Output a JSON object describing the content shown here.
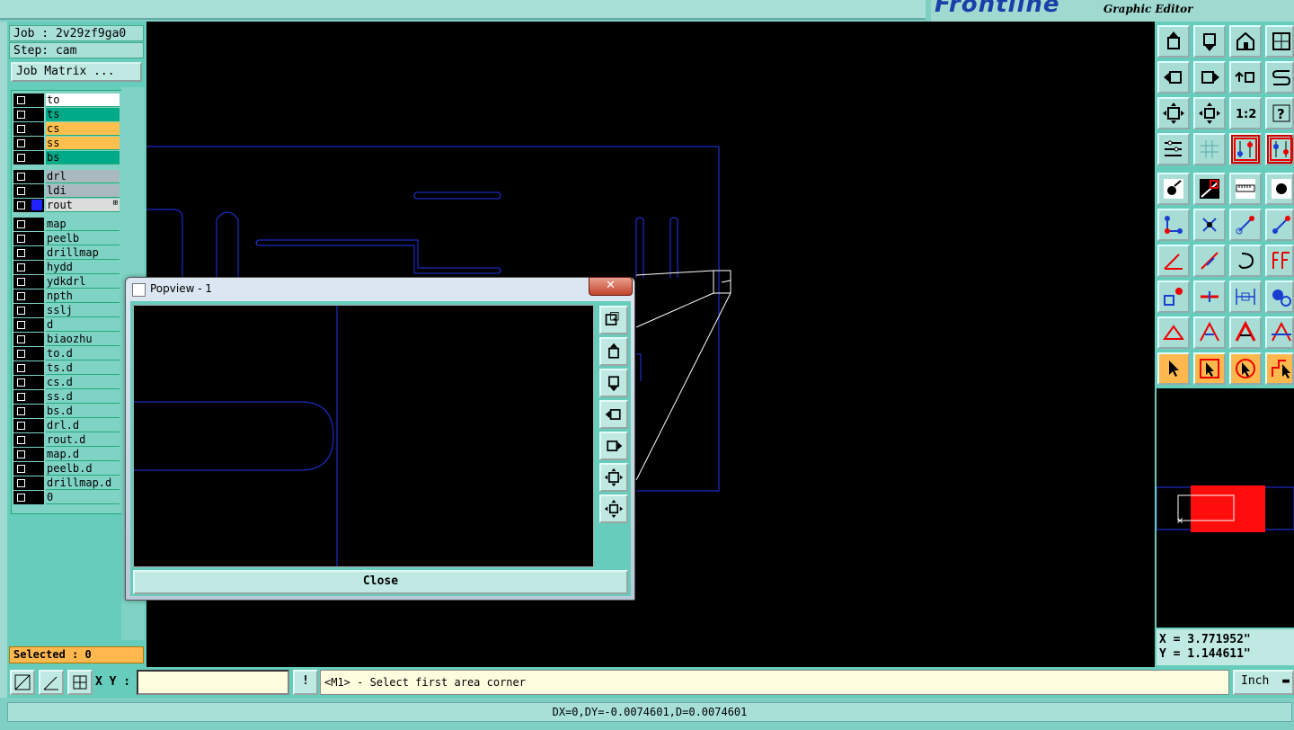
{
  "app": {
    "brand": "Frontline",
    "subtitle": "Graphic Editor"
  },
  "job": {
    "job_line": "Job : 2v29zf9ga0",
    "step_line": "Step: cam",
    "matrix_button": "Job Matrix ..."
  },
  "layers": [
    {
      "name": "to",
      "color": "#ffffff"
    },
    {
      "name": "ts",
      "color": "#00aa88"
    },
    {
      "name": "cs",
      "color": "#ffc04d"
    },
    {
      "name": "ss",
      "color": "#ffc04d"
    },
    {
      "name": "bs",
      "color": "#00aa88"
    },
    {
      "name": "drl",
      "color": "#a9b9bf"
    },
    {
      "name": "ldi",
      "color": "#a9b9bf"
    },
    {
      "name": "rout",
      "color": "#dcdcdc",
      "active": true,
      "marker": "⊞"
    },
    {
      "name": "map",
      "color": "#7fd3c5"
    },
    {
      "name": "peelb",
      "color": "#7fd3c5"
    },
    {
      "name": "drillmap",
      "color": "#7fd3c5"
    },
    {
      "name": "hydd",
      "color": "#7fd3c5"
    },
    {
      "name": "ydkdrl",
      "color": "#7fd3c5"
    },
    {
      "name": "npth",
      "color": "#7fd3c5"
    },
    {
      "name": "sslj",
      "color": "#7fd3c5"
    },
    {
      "name": "d",
      "color": "#7fd3c5"
    },
    {
      "name": "biaozhu",
      "color": "#7fd3c5"
    },
    {
      "name": "to.d",
      "color": "#7fd3c5"
    },
    {
      "name": "ts.d",
      "color": "#7fd3c5"
    },
    {
      "name": "cs.d",
      "color": "#7fd3c5"
    },
    {
      "name": "ss.d",
      "color": "#7fd3c5"
    },
    {
      "name": "bs.d",
      "color": "#7fd3c5"
    },
    {
      "name": "drl.d",
      "color": "#7fd3c5"
    },
    {
      "name": "rout.d",
      "color": "#7fd3c5"
    },
    {
      "name": "map.d",
      "color": "#7fd3c5"
    },
    {
      "name": "peelb.d",
      "color": "#7fd3c5"
    },
    {
      "name": "drillmap.d",
      "color": "#7fd3c5"
    },
    {
      "name": "0",
      "color": "#7fd3c5"
    }
  ],
  "selected": "Selected : 0",
  "popview": {
    "title": "Popview - 1",
    "close_x": "✕",
    "close_button": "Close",
    "side_tools": [
      "zoom-in-icon",
      "move-up-icon",
      "move-down-icon",
      "move-left-icon",
      "move-right-icon",
      "zoom-fit-icon",
      "zoom-center-icon"
    ]
  },
  "toolbar": {
    "rows": [
      [
        "move-up-icon",
        "move-down-icon",
        "home-icon",
        "window-icon"
      ],
      [
        "move-left-icon",
        "move-right-icon",
        "swap-icon",
        "s-curve-icon"
      ],
      [
        "zoom-fit-icon",
        "zoom-center-icon",
        "ratio-1-2-icon",
        "help-icon"
      ],
      [
        "settings-icon",
        "grid-icon",
        "snap-red-icon",
        "snap-red-2-icon"
      ],
      [
        "pad-icon",
        "line-red-icon",
        "ruler-icon",
        "dot-icon"
      ],
      [
        "node-icon",
        "cross-icon",
        "point-arrow-icon",
        "point-arrow-2-icon"
      ],
      [
        "angle-icon",
        "slash-icon",
        "arc-icon",
        "ff-icon"
      ],
      [
        "box-point-icon",
        "minus-red-icon",
        "measure-icon",
        "circles-icon"
      ],
      [
        "triangle-icon",
        "triangle-arrow-icon",
        "triangle-bold-icon",
        "triangle-cross-icon"
      ],
      [
        "select-arrow-icon",
        "select-box-icon",
        "select-circle-icon",
        "select-path-icon"
      ]
    ],
    "ratio_label": "1:2",
    "help_label": "?"
  },
  "coords": {
    "x": "X = 3.771952\"",
    "y": "Y = 1.144611\""
  },
  "command": {
    "xy_label": "X Y :",
    "xy_value": "",
    "bang": "!",
    "message": "<M1> - Select first area corner",
    "unit": "Inch"
  },
  "status": "DX=0,DY=-0.0074601,D=0.0074601",
  "colors": {
    "canvas": "#000000",
    "outline": "#2233ee",
    "panel": "#66ccbb",
    "highlight": "#ff0000"
  }
}
